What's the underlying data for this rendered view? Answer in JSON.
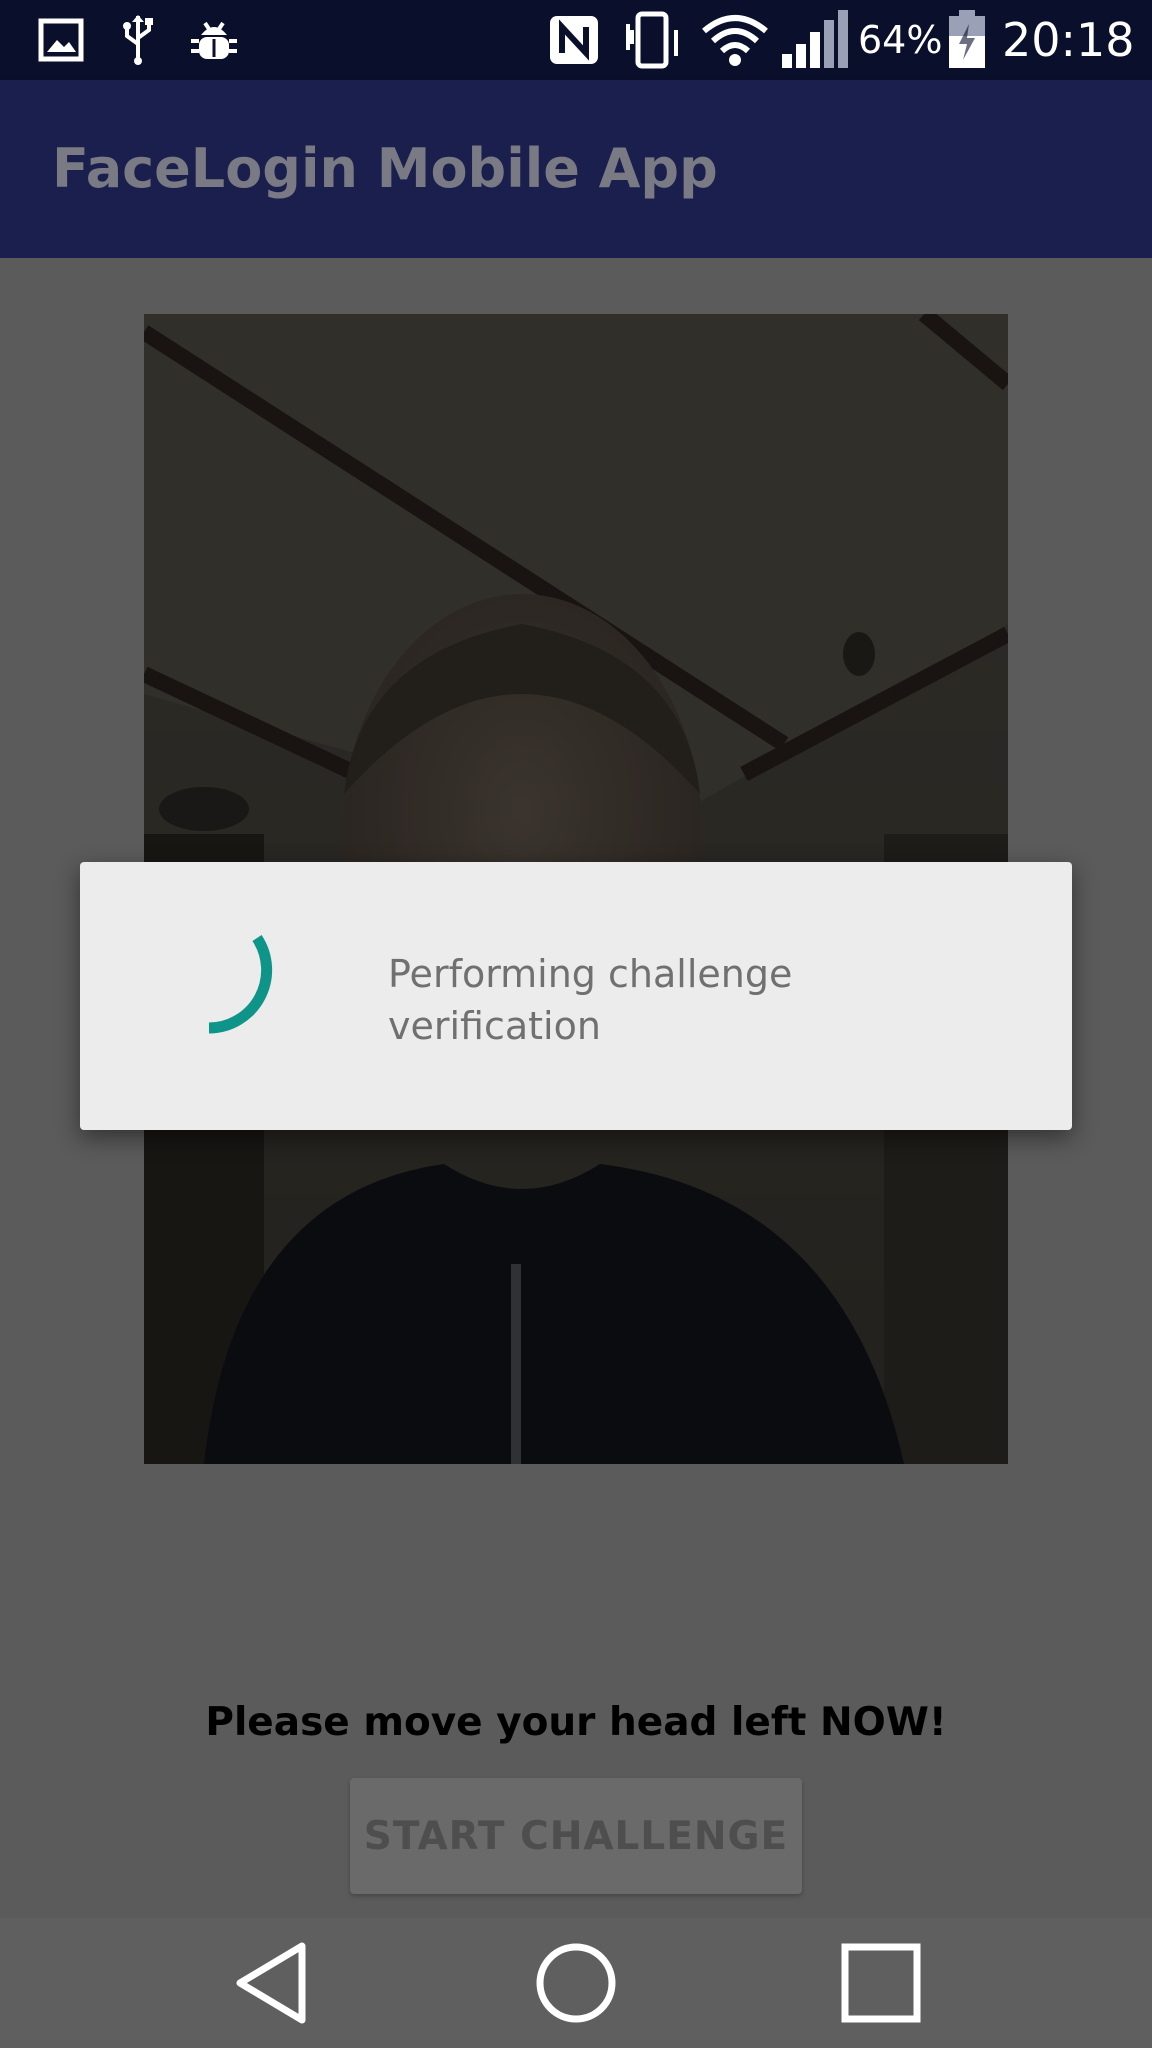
{
  "status_bar": {
    "battery_percent": "64%",
    "time": "20:18",
    "icons": [
      "gallery-icon",
      "usb-icon",
      "android-debug-icon",
      "nfc-icon",
      "vibrate-icon",
      "wifi-icon",
      "signal-icon",
      "battery-charging-icon"
    ]
  },
  "app_bar": {
    "title": "FaceLogin Mobile App"
  },
  "main": {
    "instruction": "Please move your head left NOW!",
    "start_button_label": "START CHALLENGE"
  },
  "dialog": {
    "message": "Performing challenge verification",
    "spinner_color": "#0e9488"
  },
  "nav_bar": {
    "icons": [
      "back-icon",
      "home-icon",
      "recents-icon"
    ]
  },
  "colors": {
    "status_bar": "#0a0f2c",
    "app_bar": "#1a1f4d",
    "scrim": "#5b5b5b"
  }
}
